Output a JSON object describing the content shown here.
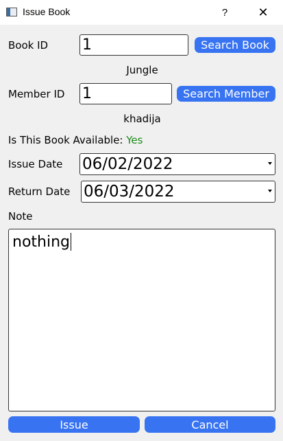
{
  "window": {
    "title": "Issue Book",
    "help_glyph": "?",
    "close_glyph": "✕"
  },
  "form": {
    "book_id_label": "Book ID",
    "book_id_value": "1",
    "search_book_label": "Search Book",
    "book_title": "Jungle",
    "member_id_label": "Member ID",
    "member_id_value": "1",
    "search_member_label": "Search Member",
    "member_name": "khadija",
    "availability_label": "Is This Book Available:",
    "availability_value": "Yes",
    "issue_date_label": "Issue Date",
    "issue_date_value": "06/02/2022",
    "return_date_label": "Return Date",
    "return_date_value": "06/03/2022",
    "note_label": "Note",
    "note_value": "nothing"
  },
  "buttons": {
    "issue": "Issue",
    "cancel": "Cancel"
  },
  "colors": {
    "accent": "#3874f2",
    "available": "#1a8a1a"
  },
  "icons": [
    "window-app-icon",
    "help-icon",
    "close-icon",
    "dropdown-arrow-icon"
  ]
}
